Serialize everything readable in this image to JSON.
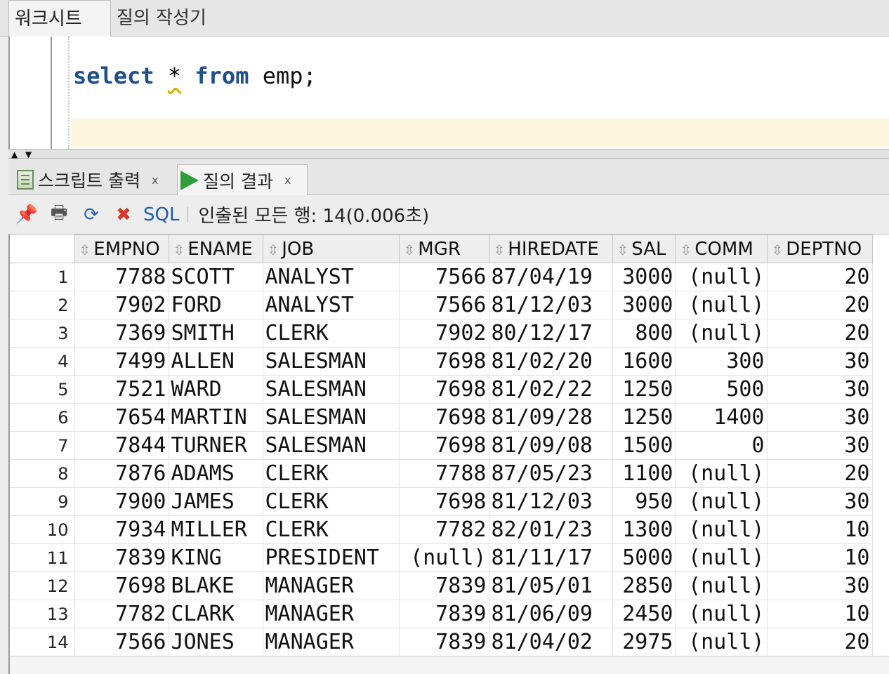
{
  "worksheet_tabs": [
    "워크시트",
    "질의 작성기"
  ],
  "editor": {
    "sql_keyword_select": "select",
    "sql_star": "*",
    "sql_keyword_from": "from",
    "sql_rest": " emp;"
  },
  "result_tabs": [
    {
      "label": "스크립트 출력",
      "close": "x"
    },
    {
      "label": "질의 결과",
      "close": "x"
    }
  ],
  "toolbar": {
    "sql_label": "SQL",
    "status": "인출된 모든 행: 14(0.006초)"
  },
  "grid": {
    "columns": [
      "EMPNO",
      "ENAME",
      "JOB",
      "MGR",
      "HIREDATE",
      "SAL",
      "COMM",
      "DEPTNO"
    ],
    "rows": [
      [
        "1",
        "7788",
        "SCOTT",
        "ANALYST",
        "7566",
        "87/04/19",
        "3000",
        "(null)",
        "20"
      ],
      [
        "2",
        "7902",
        "FORD",
        "ANALYST",
        "7566",
        "81/12/03",
        "3000",
        "(null)",
        "20"
      ],
      [
        "3",
        "7369",
        "SMITH",
        "CLERK",
        "7902",
        "80/12/17",
        "800",
        "(null)",
        "20"
      ],
      [
        "4",
        "7499",
        "ALLEN",
        "SALESMAN",
        "7698",
        "81/02/20",
        "1600",
        "300",
        "30"
      ],
      [
        "5",
        "7521",
        "WARD",
        "SALESMAN",
        "7698",
        "81/02/22",
        "1250",
        "500",
        "30"
      ],
      [
        "6",
        "7654",
        "MARTIN",
        "SALESMAN",
        "7698",
        "81/09/28",
        "1250",
        "1400",
        "30"
      ],
      [
        "7",
        "7844",
        "TURNER",
        "SALESMAN",
        "7698",
        "81/09/08",
        "1500",
        "0",
        "30"
      ],
      [
        "8",
        "7876",
        "ADAMS",
        "CLERK",
        "7788",
        "87/05/23",
        "1100",
        "(null)",
        "20"
      ],
      [
        "9",
        "7900",
        "JAMES",
        "CLERK",
        "7698",
        "81/12/03",
        "950",
        "(null)",
        "30"
      ],
      [
        "10",
        "7934",
        "MILLER",
        "CLERK",
        "7782",
        "82/01/23",
        "1300",
        "(null)",
        "10"
      ],
      [
        "11",
        "7839",
        "KING",
        "PRESIDENT",
        "(null)",
        "81/11/17",
        "5000",
        "(null)",
        "10"
      ],
      [
        "12",
        "7698",
        "BLAKE",
        "MANAGER",
        "7839",
        "81/05/01",
        "2850",
        "(null)",
        "30"
      ],
      [
        "13",
        "7782",
        "CLARK",
        "MANAGER",
        "7839",
        "81/06/09",
        "2450",
        "(null)",
        "10"
      ],
      [
        "14",
        "7566",
        "JONES",
        "MANAGER",
        "7839",
        "81/04/02",
        "2975",
        "(null)",
        "20"
      ]
    ]
  },
  "icons": [
    "pin-icon",
    "print-icon",
    "refresh-icon",
    "clear-icon",
    "script-output-icon",
    "run-icon",
    "sort-icon"
  ]
}
